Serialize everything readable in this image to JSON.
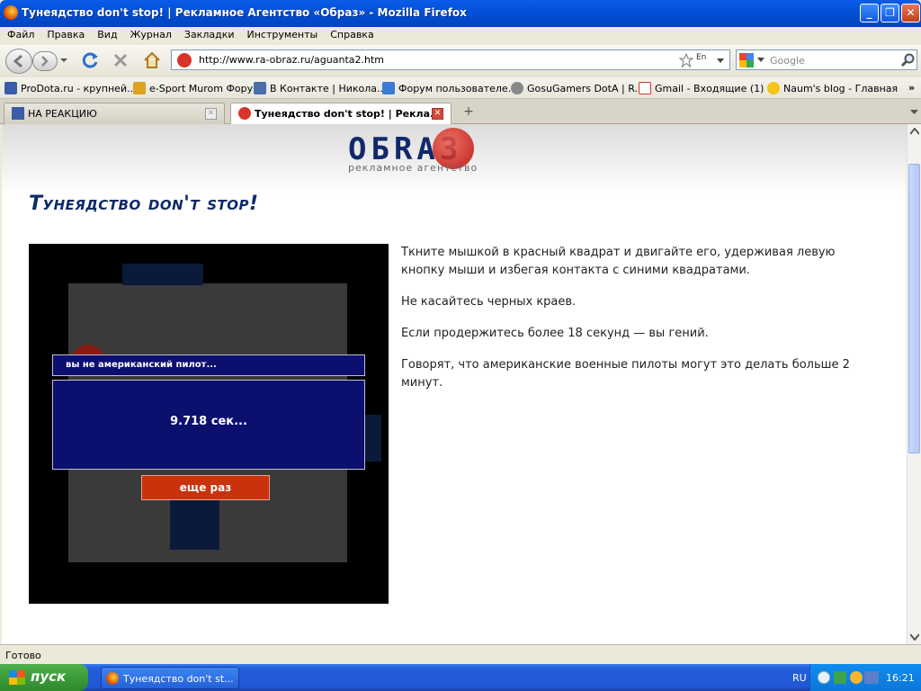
{
  "window": {
    "title": "Тунеядство don't stop! | Рекламное Агентство «Образ» - Mozilla Firefox",
    "min": "_",
    "max": "❐",
    "close": "✕"
  },
  "menu": [
    "Файл",
    "Правка",
    "Вид",
    "Журнал",
    "Закладки",
    "Инструменты",
    "Справка"
  ],
  "nav": {
    "url": "http://www.ra-obraz.ru/aguanta2.htm",
    "search_placeholder": "Google"
  },
  "bookmarks": [
    "ProDota.ru - крупней...",
    "e-Sport Murom Форум",
    "В Контакте | Никола...",
    "Форум пользователе...",
    "GosuGamers DotA | R...",
    "Gmail - Входящие (1) ...",
    "Naum's blog - Главная"
  ],
  "tabs": [
    {
      "label": "НА РЕАКЦИЮ"
    },
    {
      "label": "Тунеядство don't stop! | Рекла..."
    }
  ],
  "page": {
    "logo_main": "ОБRАЗ",
    "logo_sub": "рекламное агентство",
    "heading": "Тунеядство don't stop!",
    "paragraphs": [
      "Ткните мышкой в красный квадрат и двигайте его, удерживая левую кнопку мыши и избегая контакта с синими квадратами.",
      "Не касайтесь черных краев.",
      "Если продержитесь более 18 секунд — вы гений.",
      "Говорят, что американские военные пилоты могут это делать больше 2 минут."
    ],
    "game": {
      "header": "вы не американский пилот...",
      "result": "9.718 сек...",
      "retry": "еще раз"
    }
  },
  "status": "Готово",
  "taskbar": {
    "start": "пуск",
    "item": "Тунеядство don't st...",
    "lang": "RU",
    "time": "16:21"
  },
  "colors": {
    "accent": "#0A246A",
    "heading": "#0D2A6B",
    "game_red": "#C8330E",
    "game_blue": "#0B0F6E"
  }
}
